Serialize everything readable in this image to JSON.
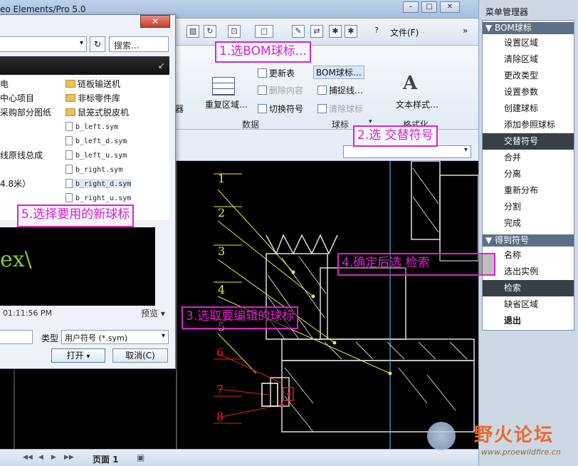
{
  "app": {
    "title": "eo Elements/Pro 5.0",
    "minimize": "–",
    "maximize": "□",
    "close": "✕"
  },
  "toolbar": {
    "file_menu": "文件(F)",
    "more": "»"
  },
  "ribbon": {
    "btn_partial": "器",
    "region_button": "重复区域…",
    "update_table": "更新表",
    "delete_content": "删除内容",
    "switch_symbol": "切换符号",
    "bom_balloon": "BOM球标…",
    "snap_line": "捕捉线…",
    "clear_balloon": "清除球标",
    "text_style": "文本样式…",
    "group_data": "数据",
    "group_balloon": "球标",
    "group_format": "格式化",
    "group_arrow": "▾"
  },
  "dialog": {
    "close": "✕",
    "path_arrow": "▾",
    "refresh": "↻",
    "search_placeholder": "搜索...",
    "left_items": [
      "电",
      "中心项目",
      "采购部分图纸",
      "线原线总成",
      "4.8米）"
    ],
    "folders": [
      "链板输送机",
      "非标零件库",
      "鼠笼式脱皮机"
    ],
    "files": [
      "b_left.sym",
      "b_left_d.sym",
      "b_left_u.sym",
      "b_right.sym",
      "b_right_d.sym",
      "b_right_u.sym"
    ],
    "preview_text": "ex\\",
    "preview_time": "01:11:56 PM",
    "preview_label": "预览 ▾",
    "type_label": "类型",
    "type_value": "用户符号 (*.sym)",
    "open_label": "打开",
    "open_arrow": "▾",
    "cancel_label": "取消(C)"
  },
  "menu_manager": {
    "title": "菜单管理器",
    "section1": "BOM球标",
    "items1": [
      "设置区域",
      "清除区域",
      "更改类型",
      "设置参数",
      "创建球标",
      "添加参照球标",
      "交替符号",
      "合并",
      "分离",
      "重新分布",
      "分割",
      "完成"
    ],
    "selected1": "交替符号",
    "section2": "得到符号",
    "items2": [
      "名称",
      "选出实例",
      "检索",
      "缺省区域",
      "退出"
    ],
    "selected2": "检索"
  },
  "steps": {
    "s1": "1.选BOM球标...",
    "s2": "2.选  交替符号",
    "s3": "3.选取要编辑的球标",
    "s4": "4.确定后选  检索",
    "s5": "5.选择要用的新球标"
  },
  "drawing": {
    "balloon_numbers": [
      "1",
      "2",
      "3",
      "4",
      "5",
      "6",
      "7",
      "8"
    ]
  },
  "status": {
    "page_label": "页面 1"
  },
  "watermark": {
    "title": "野火论坛",
    "url": "www.proewildfire.cn"
  },
  "colors": {
    "annotation": "#e020d0",
    "drawing_lines": "#ffffff",
    "leader_lines": "#e8e84a",
    "balloon_red": "#e02020",
    "menu_header": "#5d6f86",
    "menu_selected": "#3a3f46"
  }
}
